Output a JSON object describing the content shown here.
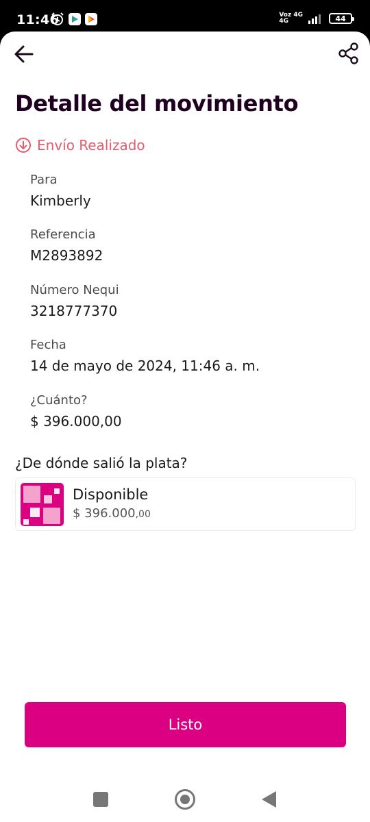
{
  "status_bar": {
    "time": "11:46",
    "network_top": "Voz 4G",
    "network_bottom": "4G",
    "battery": "44"
  },
  "header": {
    "title": "Detalle del movimiento"
  },
  "movement": {
    "status": "Envío Realizado",
    "status_color": "#e85a6e",
    "fields": [
      {
        "label": "Para",
        "value": "Kimberly"
      },
      {
        "label": "Referencia",
        "value": "M2893892"
      },
      {
        "label": "Número Nequi",
        "value": "3218777370"
      },
      {
        "label": "Fecha",
        "value": "14 de mayo de 2024, 11:46 a. m."
      },
      {
        "label": "¿Cuánto?",
        "value": "$ 396.000,00"
      }
    ]
  },
  "source": {
    "title": "¿De dónde salió la plata?",
    "pocket_name": "Disponible",
    "pocket_amount_main": "$ 396.000",
    "pocket_amount_decimals": ",00"
  },
  "actions": {
    "done_label": "Listo"
  },
  "colors": {
    "brand": "#da0081",
    "title": "#200020"
  }
}
